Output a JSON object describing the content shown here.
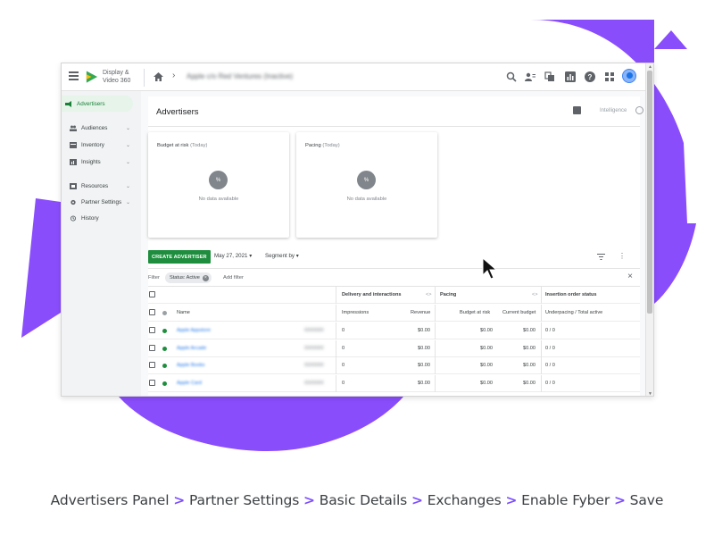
{
  "colors": {
    "accent_purple": "#8a4dfc",
    "create_button_green": "#1e8e3e",
    "active_nav_bg": "#e6f4ea",
    "status_active_dot": "#1e8e3e",
    "status_inactive_dot": "#80868b",
    "caption_separator": "#7c4dff"
  },
  "app": {
    "brand_line1": "Display &",
    "brand_line2": "Video 360",
    "breadcrumb_separator": "›",
    "breadcrumb": "Apple c/o Red Ventures (Inactive)"
  },
  "topbar_icons": [
    "search-icon",
    "user-list-icon",
    "copy-icon",
    "reports-icon",
    "help-icon",
    "apps-grid-icon",
    "avatar"
  ],
  "sidebar": {
    "items": [
      {
        "label": "Advertisers",
        "icon": "advertisers-icon",
        "active": true,
        "expandable": false
      },
      {
        "label": "Audiences",
        "icon": "audiences-icon",
        "active": false,
        "expandable": true
      },
      {
        "label": "Inventory",
        "icon": "inventory-icon",
        "active": false,
        "expandable": true
      },
      {
        "label": "Insights",
        "icon": "insights-icon",
        "active": false,
        "expandable": true
      },
      {
        "label": "Resources",
        "icon": "resources-icon",
        "active": false,
        "expandable": true
      },
      {
        "label": "Partner Settings",
        "icon": "gear-icon",
        "active": false,
        "expandable": true
      },
      {
        "label": "History",
        "icon": "history-icon",
        "active": false,
        "expandable": false
      }
    ]
  },
  "page": {
    "title": "Advertisers",
    "intelligence_label": "Intelligence"
  },
  "cards": [
    {
      "title": "Budget at risk",
      "subtitle": "(Today)",
      "badge": "%",
      "empty": "No data available"
    },
    {
      "title": "Pacing",
      "subtitle": "(Today)",
      "badge": "%",
      "empty": "No data available"
    }
  ],
  "toolbar": {
    "create_label": "CREATE ADVERTISER",
    "date_label": "May 27, 2021",
    "segment_label": "Segment by"
  },
  "filter": {
    "label": "Filter",
    "chip": "Status: Active",
    "add_label": "Add filter"
  },
  "table": {
    "groups": {
      "delivery": "Delivery and interactions",
      "pacing": "Pacing",
      "insertion": "Insertion order status",
      "toggle": "<>"
    },
    "headers": {
      "name": "Name",
      "impressions": "Impressions",
      "revenue": "Revenue",
      "budget_at_risk": "Budget at risk",
      "current_budget": "Current budget",
      "underpacing": "Underpacing / Total active"
    },
    "rows": [
      {
        "name": "Apple Appstore",
        "id": "0000000",
        "impressions": "0",
        "revenue": "$0.00",
        "budget_at_risk": "$0.00",
        "current_budget": "$0.00",
        "underpacing": "0 / 0"
      },
      {
        "name": "Apple Arcade",
        "id": "0000000",
        "impressions": "0",
        "revenue": "$0.00",
        "budget_at_risk": "$0.00",
        "current_budget": "$0.00",
        "underpacing": "0 / 0"
      },
      {
        "name": "Apple Books",
        "id": "0000000",
        "impressions": "0",
        "revenue": "$0.00",
        "budget_at_risk": "$0.00",
        "current_budget": "$0.00",
        "underpacing": "0 / 0"
      },
      {
        "name": "Apple Card",
        "id": "0000000",
        "impressions": "0",
        "revenue": "$0.00",
        "budget_at_risk": "$0.00",
        "current_budget": "$0.00",
        "underpacing": "0 / 0"
      }
    ]
  },
  "caption": {
    "steps": [
      "Advertisers Panel",
      "Partner Settings",
      "Basic Details",
      "Exchanges",
      "Enable Fyber",
      "Save"
    ],
    "separator": ">"
  }
}
